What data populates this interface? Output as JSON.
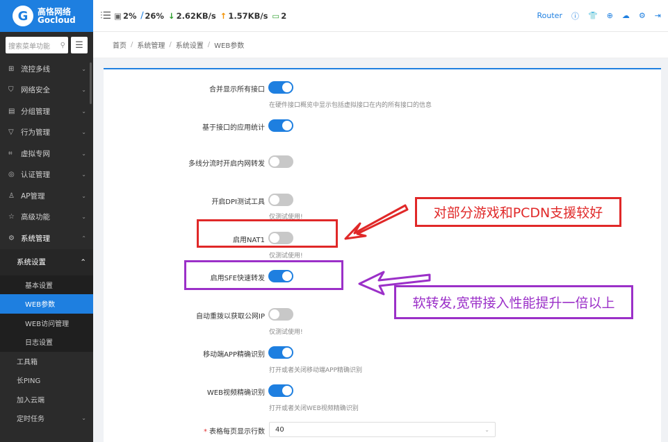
{
  "brand": {
    "name_cn": "高恪网络",
    "name_en": "Gocloud"
  },
  "topbar": {
    "cpu": "2%",
    "mem": "26%",
    "down": "2.62KB/s",
    "up": "1.57KB/s",
    "devices": "2",
    "router_label": "Router"
  },
  "sidebar": {
    "search_placeholder": "搜索菜单功能",
    "items": [
      {
        "label": "流控多线",
        "icon": "signal-icon"
      },
      {
        "label": "网络安全",
        "icon": "shield-icon"
      },
      {
        "label": "分组管理",
        "icon": "list-icon"
      },
      {
        "label": "行为管理",
        "icon": "filter-icon"
      },
      {
        "label": "虚拟专网",
        "icon": "network-icon"
      },
      {
        "label": "认证管理",
        "icon": "check-shield-icon"
      },
      {
        "label": "AP管理",
        "icon": "ap-icon"
      },
      {
        "label": "高级功能",
        "icon": "star-icon"
      },
      {
        "label": "系统管理",
        "icon": "gear-icon"
      }
    ],
    "sub_group_label": "系统设置",
    "sub_items": [
      "基本设置",
      "WEB参数",
      "WEB访问管理",
      "日志设置"
    ],
    "plain_items": [
      "工具箱",
      "长PING",
      "加入云端",
      "定时任务"
    ]
  },
  "breadcrumb": [
    "首页",
    "系统管理",
    "系统设置",
    "WEB参数"
  ],
  "settings": [
    {
      "label": "合并显示所有接口",
      "on": true,
      "help": "在硬件接口概览中显示包括虚拟接口在内的所有接口的信息"
    },
    {
      "label": "基于接口的应用统计",
      "on": true,
      "help": ""
    },
    {
      "label": "多线分流时开启内网转发",
      "on": false,
      "help": ""
    },
    {
      "label": "开启DPI测试工具",
      "on": false,
      "help": "仅测试使用!"
    },
    {
      "label": "启用NAT1",
      "on": false,
      "help": "仅测试使用!"
    },
    {
      "label": "启用SFE快速转发",
      "on": true,
      "help": ""
    },
    {
      "label": "自动重拨以获取公网IP",
      "on": false,
      "help": "仅测试使用!"
    },
    {
      "label": "移动端APP精确识别",
      "on": true,
      "help": "打开或者关闭移动端APP精确识别"
    },
    {
      "label": "WEB视频精确识别",
      "on": true,
      "help": "打开或者关闭WEB视频精确识别"
    }
  ],
  "rows_per_page": {
    "label": "表格每页显示行数",
    "value": "40"
  },
  "annotations": {
    "red_text": "对部分游戏和PCDN支援较好",
    "purple_text": "软转发,宽带接入性能提升一倍以上",
    "red_color": "#e02828",
    "purple_color": "#9b30c8"
  }
}
